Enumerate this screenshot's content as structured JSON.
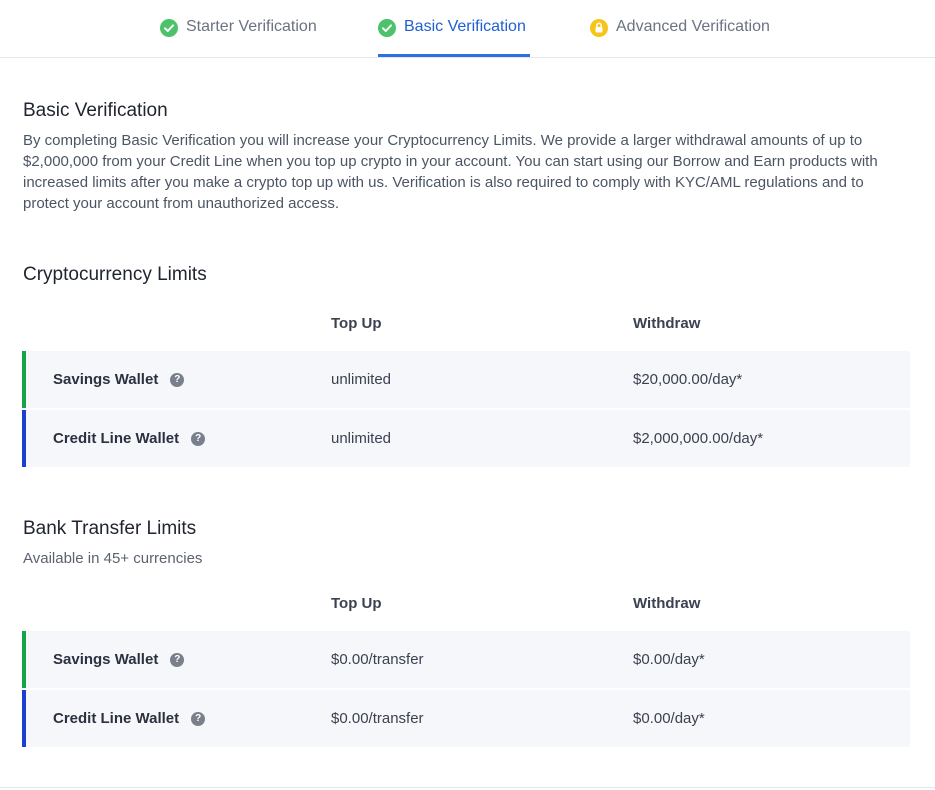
{
  "tabs": [
    {
      "label": "Starter Verification",
      "status": "complete",
      "icon": "check-circle-icon"
    },
    {
      "label": "Basic Verification",
      "status": "complete",
      "icon": "check-circle-icon",
      "active": true
    },
    {
      "label": "Advanced Verification",
      "status": "locked",
      "icon": "lock-icon"
    }
  ],
  "intro": {
    "title": "Basic Verification",
    "text": "By completing Basic Verification you will increase your Cryptocurrency Limits. We provide a larger withdrawal amounts of up to $2,000,000 from your Credit Line when you top up crypto in your account. You can start using our Borrow and Earn products with increased limits after you make a crypto top up with us. Verification is also required to comply with KYC/AML regulations and to protect your account from unauthorized access."
  },
  "crypto": {
    "title": "Cryptocurrency Limits",
    "col_topup": "Top Up",
    "col_withdraw": "Withdraw",
    "rows": [
      {
        "name": "Savings Wallet",
        "topup": "unlimited",
        "withdraw": "$20,000.00/day*"
      },
      {
        "name": "Credit Line Wallet",
        "topup": "unlimited",
        "withdraw": "$2,000,000.00/day*"
      }
    ]
  },
  "bank": {
    "title": "Bank Transfer Limits",
    "subtitle": "Available in 45+ currencies",
    "col_topup": "Top Up",
    "col_withdraw": "Withdraw",
    "rows": [
      {
        "name": "Savings Wallet",
        "topup": "$0.00/transfer",
        "withdraw": "$0.00/day*"
      },
      {
        "name": "Credit Line Wallet",
        "topup": "$0.00/transfer",
        "withdraw": "$0.00/day*"
      }
    ]
  },
  "colors": {
    "accent": "#2f6fe4",
    "check_green": "#4cc26a",
    "lock_yellow": "#f5c518",
    "savings_bar": "#16a34a",
    "credit_bar": "#1d3fcf"
  }
}
